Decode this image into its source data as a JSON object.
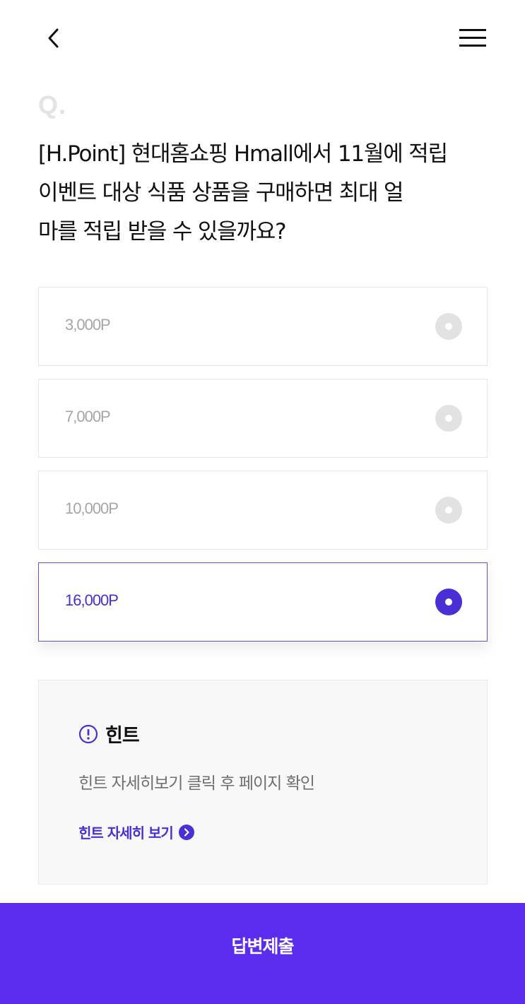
{
  "header": {
    "back_icon": "chevron-left-icon",
    "menu_icon": "hamburger-menu-icon"
  },
  "quiz": {
    "q_mark": "Q.",
    "question_lines": [
      "[H.Point] 현대홈쇼핑 Hmall에서 11월에 적립",
      "이벤트 대상 식품 상품을 구매하면 최대 얼",
      "마를 적립 받을 수 있을까요?"
    ],
    "options": [
      {
        "label": "3,000P",
        "selected": false
      },
      {
        "label": "7,000P",
        "selected": false
      },
      {
        "label": "10,000P",
        "selected": false
      },
      {
        "label": "16,000P",
        "selected": true
      }
    ]
  },
  "hint": {
    "icon": "exclamation-circle-icon",
    "title": "힌트",
    "description": "힌트 자세히보기 클릭 후 페이지 확인",
    "link_label": "힌트 자세히 보기",
    "link_icon": "chevron-right-circle-icon"
  },
  "submit": {
    "label": "답변제출"
  },
  "colors": {
    "accent": "#5b2cf0",
    "selected_text": "#4a2ed6",
    "unselected_radio": "#e2e2e2",
    "hint_background": "#f8f8f8"
  }
}
